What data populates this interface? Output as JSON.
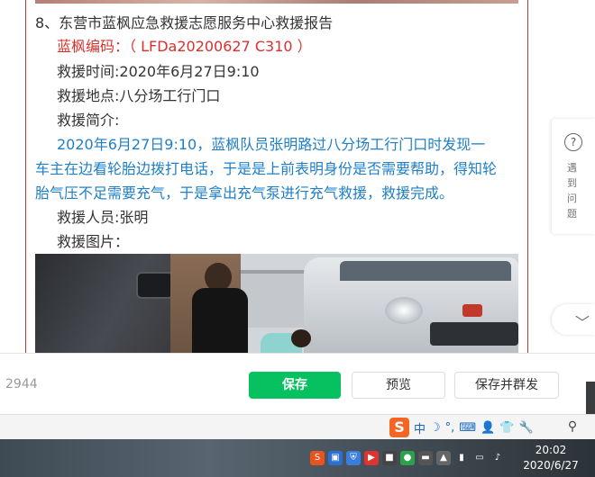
{
  "article": {
    "heading": "8、东营市蓝枫应急救援志愿服务中心救援报告",
    "code": "蓝枫编码：（ LFDa20200627  C310 ）",
    "time": "救援时间:2020年6月27日9:10",
    "location": "救援地点:八分场工行门口",
    "summary_label": "救援简介:",
    "summary_lines": [
      " 2020年6月27日9:10，蓝枫队员张明路过八分场工行门口时发现一",
      "车主在边看轮胎边拨打电话，于是是上前表明身份是否需要帮助，得知轮",
      "胎气压不足需要充气，于是拿出充气泵进行充气救援，救援完成。"
    ],
    "rescuer": "救援人员:张明",
    "images_label": "救援图片："
  },
  "help": {
    "icon": "?",
    "label_chars": [
      "遇",
      "到",
      "问",
      "题"
    ]
  },
  "collapse": {
    "icon": "chevron-down-icon",
    "glyph": "﹀"
  },
  "actionbar": {
    "word_count": "2944",
    "save_label": "保存",
    "preview_label": "预览",
    "save_publish_label": "保存并群发"
  },
  "ime": {
    "logo": "S",
    "items": [
      "中",
      "☽",
      "°,",
      "⌨",
      "👤",
      "👕",
      "🔧"
    ]
  },
  "taskbar": {
    "time": "20:02",
    "date": "2020/6/27"
  },
  "colors": {
    "accent_green": "#07c160",
    "red_text": "#d9302c",
    "blue_text": "#1f7fc4"
  }
}
